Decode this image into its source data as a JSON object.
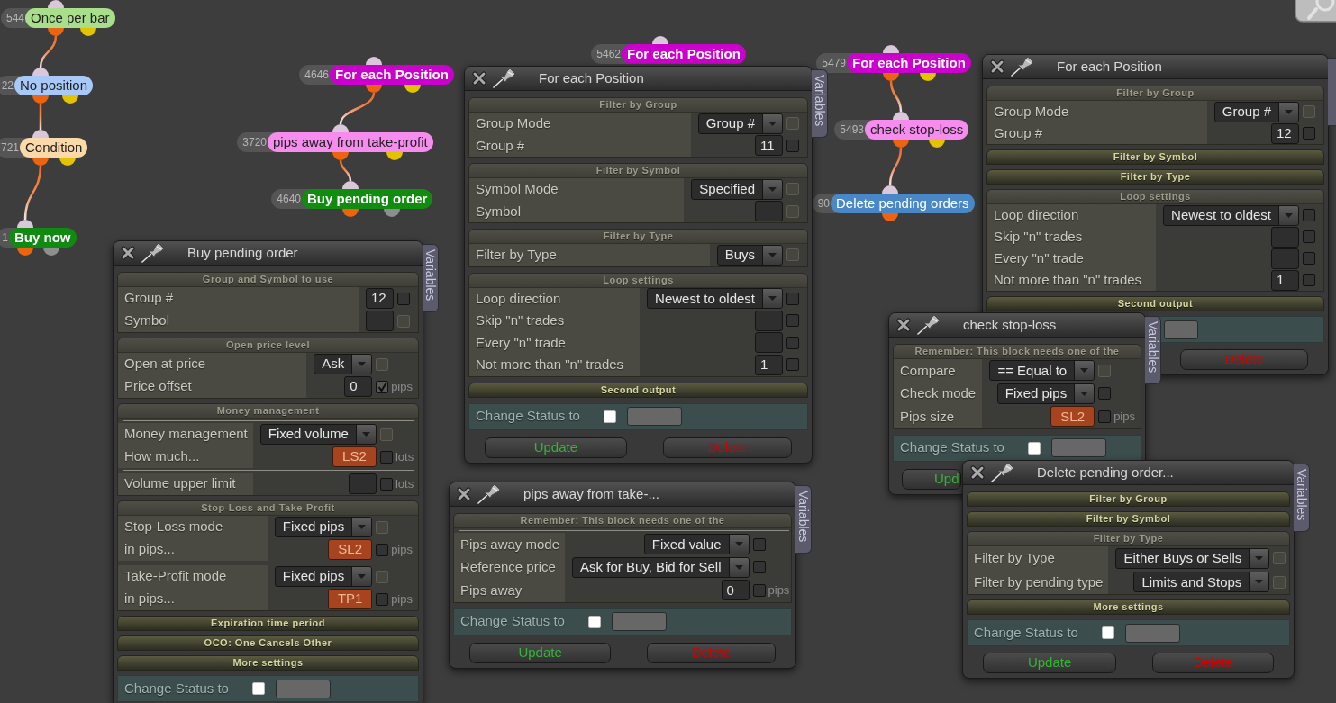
{
  "canvas": {
    "flows": [
      {
        "number": "544",
        "label": "Once per bar",
        "kind": "condition",
        "color": "#a9df8b",
        "children": [
          {
            "number": "22",
            "label": "No position",
            "kind": "condition",
            "color": "#a8c9f7",
            "children": [
              {
                "number": "721",
                "label": "Condition",
                "kind": "condition",
                "color": "#fcd9a8",
                "children": [
                  {
                    "number": "1",
                    "label": "Buy now",
                    "kind": "trade",
                    "color": "#108a10"
                  }
                ]
              }
            ]
          }
        ]
      },
      {
        "number": "4646",
        "label": "For each Position",
        "kind": "loop",
        "color": "#cc00cc",
        "children": [
          {
            "number": "3720",
            "label": "pips away from take-profit",
            "kind": "condition",
            "color": "#f78cef",
            "children": [
              {
                "number": "4640",
                "label": "Buy pending order",
                "kind": "trade",
                "color": "#118c11"
              }
            ]
          }
        ]
      },
      {
        "number": "5462",
        "label": "For each Position",
        "kind": "loop",
        "color": "#cc00cc"
      },
      {
        "number": "5479",
        "label": "For each Position",
        "kind": "loop",
        "color": "#cc00cc",
        "children": [
          {
            "number": "5493",
            "label": "check stop-loss",
            "kind": "condition",
            "color": "#f78cef",
            "children": [
              {
                "number": "90",
                "label": "Delete pending orders",
                "kind": "action",
                "color": "#4a87c6"
              }
            ]
          }
        ]
      }
    ]
  },
  "windows": [
    {
      "title": "Buy pending order",
      "side_tab": "Variables",
      "sections": [
        {
          "title": "Group and Symbol to use",
          "expanded": true,
          "groups": [
            [
              {
                "label": "Group #",
                "kind": "input",
                "value": "12",
                "checked": false,
                "disabled": false
              },
              {
                "label": "Symbol",
                "kind": "input",
                "checked": false,
                "disabled": true
              }
            ]
          ]
        },
        {
          "title": "Open price level",
          "expanded": true,
          "groups": [
            [
              {
                "label": "Open at price",
                "kind": "dropdown",
                "value": "Ask",
                "checked": false,
                "disabled": true
              },
              {
                "label": "Price offset",
                "kind": "input",
                "value": "0",
                "checked": true,
                "disabled": false,
                "unit": "pips"
              }
            ]
          ]
        },
        {
          "title": "Money management",
          "expanded": true,
          "groups": [
            [
              {
                "label": "Money management",
                "kind": "dropdown",
                "value": "Fixed volume",
                "checked": false,
                "disabled": true
              },
              {
                "label": "How much...",
                "kind": "variable",
                "value": "LS2",
                "checked": false,
                "disabled": false,
                "unit": "lots"
              }
            ],
            [
              {
                "label": "Volume upper limit",
                "kind": "input",
                "checked": false,
                "disabled": false,
                "unit": "lots"
              }
            ]
          ]
        },
        {
          "title": "Stop-Loss and Take-Profit",
          "expanded": true,
          "groups": [
            [
              {
                "label": "Stop-Loss mode",
                "kind": "dropdown",
                "value": "Fixed pips",
                "checked": false,
                "disabled": true
              },
              {
                "label": "in pips...",
                "kind": "variable",
                "value": "SL2",
                "checked": false,
                "disabled": false,
                "unit": "pips"
              }
            ],
            [
              {
                "label": "Take-Profit mode",
                "kind": "dropdown",
                "value": "Fixed pips",
                "checked": false,
                "disabled": true
              },
              {
                "label": "in pips...",
                "kind": "variable",
                "value": "TP1",
                "checked": false,
                "disabled": false,
                "unit": "pips"
              }
            ]
          ]
        },
        {
          "title": "Expiration time period",
          "expanded": false
        },
        {
          "title": "OCO: One Cancels Other",
          "expanded": false
        },
        {
          "title": "More settings",
          "expanded": false
        }
      ],
      "status_label": "Change Status to",
      "status_checked": false
    },
    {
      "title": "For each Position",
      "side_tab": "Variables",
      "sections": [
        {
          "title": "Filter by Group",
          "expanded": true,
          "groups": [
            [
              {
                "label": "Group Mode",
                "kind": "dropdown",
                "value": "Group #",
                "checked": false,
                "disabled": true
              },
              {
                "label": "Group #",
                "kind": "input",
                "value": "11",
                "checked": false,
                "disabled": false
              }
            ]
          ]
        },
        {
          "title": "Filter by Symbol",
          "expanded": true,
          "groups": [
            [
              {
                "label": "Symbol Mode",
                "kind": "dropdown",
                "value": "Specified",
                "checked": false,
                "disabled": true
              },
              {
                "label": "Symbol",
                "kind": "input",
                "checked": false,
                "disabled": true
              }
            ]
          ]
        },
        {
          "title": "Filter by Type",
          "expanded": true,
          "groups": [
            [
              {
                "label": "Filter by Type",
                "kind": "dropdown",
                "value": "Buys",
                "checked": false,
                "disabled": true
              }
            ]
          ]
        },
        {
          "title": "Loop settings",
          "expanded": true,
          "groups": [
            [
              {
                "label": "Loop direction",
                "kind": "dropdown",
                "value": "Newest to oldest",
                "checked": false,
                "disabled": false
              },
              {
                "label": "Skip \"n\" trades",
                "kind": "input",
                "checked": false,
                "disabled": false
              },
              {
                "label": "Every \"n\" trade",
                "kind": "input",
                "checked": false,
                "disabled": false
              },
              {
                "label": "Not more than \"n\" trades",
                "kind": "input",
                "value": "1",
                "checked": false,
                "disabled": false
              }
            ]
          ]
        },
        {
          "title": "Second output",
          "expanded": false
        }
      ],
      "status_label": "Change Status to",
      "status_checked": false,
      "buttons": [
        {
          "label": "Update",
          "kind": "update"
        },
        {
          "label": "Delete",
          "kind": "delete"
        }
      ]
    },
    {
      "title": "pips away from take-...",
      "side_tab": "Variables",
      "sections": [
        {
          "title": "Remember: This block needs one of the",
          "expanded": true,
          "groups": [
            [
              {
                "label": "Pips away mode",
                "kind": "dropdown",
                "value": "Fixed value",
                "checked": false,
                "disabled": false
              },
              {
                "label": "Reference price",
                "kind": "dropdown",
                "value": "Ask for Buy, Bid for Sell",
                "checked": false,
                "disabled": false
              },
              {
                "label": "Pips away",
                "kind": "input",
                "value": "0",
                "checked": false,
                "disabled": false,
                "unit": "pips"
              }
            ]
          ]
        }
      ],
      "status_label": "Change Status to",
      "status_checked": false,
      "buttons": [
        {
          "label": "Update",
          "kind": "update"
        },
        {
          "label": "Delete",
          "kind": "delete"
        }
      ]
    },
    {
      "title": "For each Position",
      "sections": [
        {
          "title": "Filter by Group",
          "expanded": true,
          "groups": [
            [
              {
                "label": "Group Mode",
                "kind": "dropdown",
                "value": "Group #",
                "checked": false,
                "disabled": true
              },
              {
                "label": "Group #",
                "kind": "input",
                "value": "12",
                "checked": false,
                "disabled": false
              }
            ]
          ]
        },
        {
          "title": "Filter by Symbol",
          "expanded": false
        },
        {
          "title": "Filter by Type",
          "expanded": false
        },
        {
          "title": "Loop settings",
          "expanded": true,
          "groups": [
            [
              {
                "label": "Loop direction",
                "kind": "dropdown",
                "value": "Newest to oldest",
                "checked": false,
                "disabled": false
              },
              {
                "label": "Skip \"n\" trades",
                "kind": "input",
                "checked": false,
                "disabled": false
              },
              {
                "label": "Every \"n\" trade",
                "kind": "input",
                "checked": false,
                "disabled": false
              },
              {
                "label": "Not more than \"n\" trades",
                "kind": "input",
                "value": "1",
                "checked": false,
                "disabled": false
              }
            ]
          ]
        },
        {
          "title": "Second output",
          "expanded": false
        }
      ],
      "buttons": [
        {
          "label": "Delete",
          "kind": "delete"
        }
      ]
    },
    {
      "title": "check stop-loss",
      "side_tab": "Variables",
      "sections": [
        {
          "title": "Remember: This block needs one of the",
          "expanded": true,
          "groups": [
            [
              {
                "label": "Compare",
                "kind": "dropdown",
                "value": "== Equal to",
                "checked": false,
                "disabled": true
              },
              {
                "label": "Check mode",
                "kind": "dropdown",
                "value": "Fixed pips",
                "checked": false,
                "disabled": false
              },
              {
                "label": "Pips size",
                "kind": "variable",
                "value": "SL2",
                "checked": false,
                "disabled": false,
                "unit": "pips"
              }
            ]
          ]
        }
      ],
      "status_label": "Change Status to",
      "status_checked": false,
      "buttons": [
        {
          "label": "Upd",
          "kind": "update"
        }
      ]
    },
    {
      "title": "Delete pending order...",
      "side_tab": "Variables",
      "sections": [
        {
          "title": "Filter by Group",
          "expanded": false
        },
        {
          "title": "Filter by Symbol",
          "expanded": false
        },
        {
          "title": "Filter by Type",
          "expanded": true,
          "groups": [
            [
              {
                "label": "Filter by Type",
                "kind": "dropdown",
                "value": "Either Buys or Sells",
                "checked": false,
                "disabled": true
              },
              {
                "label": "Filter by pending type",
                "kind": "dropdown",
                "value": "Limits and Stops",
                "checked": false,
                "disabled": true
              }
            ]
          ]
        },
        {
          "title": "More settings",
          "expanded": false
        }
      ],
      "status_label": "Change Status to",
      "status_checked": false,
      "buttons": [
        {
          "label": "Update",
          "kind": "update"
        },
        {
          "label": "Delete",
          "kind": "delete"
        }
      ]
    }
  ]
}
